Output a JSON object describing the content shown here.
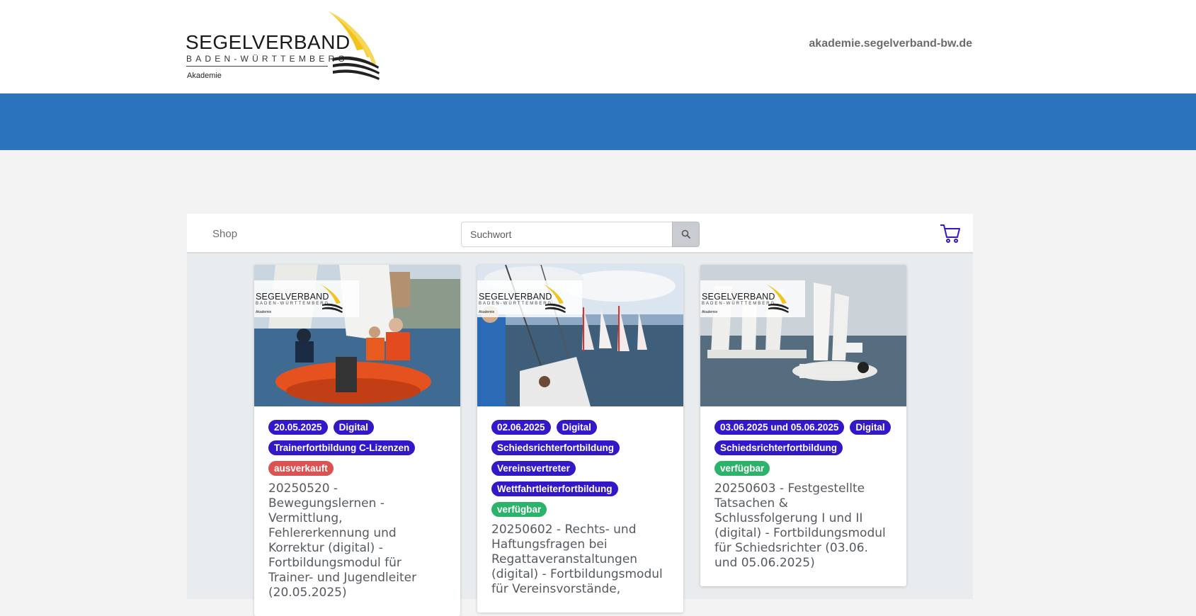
{
  "header": {
    "logo": {
      "name": "SEGELVERBAND",
      "region": "BADEN-WÜRTTEMBERG",
      "subtitle": "Akademie"
    },
    "site_url": "akademie.segelverband-bw.de"
  },
  "colors": {
    "banner": "#2b74bd",
    "badge_primary": "#3218c7",
    "badge_soldout": "#dc5151",
    "badge_available": "#2cb36a"
  },
  "navbar": {
    "shop_label": "Shop",
    "search_placeholder": "Suchwort",
    "search_icon": "search-icon",
    "cart_icon": "cart-icon"
  },
  "cards": [
    {
      "badges": [
        "20.05.2025",
        "Digital",
        "Trainerfortbildung C-Lizenzen"
      ],
      "status": "ausverkauft",
      "title": "20250520 - Bewegungslernen - Vermittlung, Fehlererkennung und Korrektur (digital) - Fortbildungsmodul für Trainer- und Jugendleiter (20.05.2025)"
    },
    {
      "badges": [
        "02.06.2025",
        "Digital",
        "Schiedsrichterfortbildung",
        "Vereinsvertreter",
        "Wettfahrtleiterfortbildung"
      ],
      "status": "verfügbar",
      "title": "20250602 - Rechts- und Haftungsfragen bei Regattaveranstaltungen (digital) - Fortbildungsmodul für Vereinsvorstände,"
    },
    {
      "badges": [
        "03.06.2025 und 05.06.2025",
        "Digital",
        "Schiedsrichterfortbildung"
      ],
      "status": "verfügbar",
      "title": "20250603 - Festgestellte Tatsachen & Schlussfolgerung I und II (digital) - Fortbildungsmodul für Schiedsrichter (03.06. und 05.06.2025)"
    }
  ]
}
